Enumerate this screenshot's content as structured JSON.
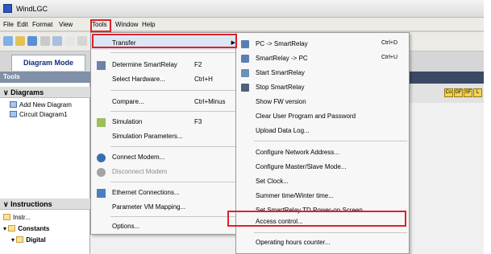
{
  "window": {
    "title": "WindLGC"
  },
  "menubar": [
    "File",
    "Edit",
    "Format",
    "View",
    "Tools",
    "Window",
    "Help"
  ],
  "tabs": {
    "diagram_mode": "Diagram Mode"
  },
  "tools_panel": {
    "header": "Tools",
    "diagrams_section": "Diagrams",
    "add_new_diagram": "Add New Diagram",
    "circuit_diagram": "Circuit Diagram1",
    "instructions_section": "Instructions",
    "instr_item": "Instr...",
    "constants_item": "Constants",
    "digital_item": "Digital"
  },
  "palette_buttons": [
    "Co",
    "GF",
    "SF",
    "L"
  ],
  "tools_menu": {
    "transfer": "Transfer",
    "determine_smartrelay": {
      "label": "Determine SmartRelay",
      "shortcut": "F2"
    },
    "select_hardware": {
      "label": "Select Hardware...",
      "shortcut": "Ctrl+H"
    },
    "compare": {
      "label": "Compare...",
      "shortcut": "Ctrl+Minus"
    },
    "simulation": {
      "label": "Simulation",
      "shortcut": "F3"
    },
    "simulation_parameters": "Simulation Parameters...",
    "connect_modem": "Connect Modem...",
    "disconnect_modem": "Disconnect Modem",
    "ethernet_connections": "Ethernet Connections...",
    "parameter_vm_mapping": "Parameter VM Mapping...",
    "options": "Options..."
  },
  "transfer_menu": {
    "pc_to_smartrelay": {
      "label": "PC -> SmartRelay",
      "shortcut": "Ctrl+D"
    },
    "smartrelay_to_pc": {
      "label": "SmartRelay -> PC",
      "shortcut": "Ctrl+U"
    },
    "start_smartrelay": "Start SmartRelay",
    "stop_smartrelay": "Stop SmartRelay",
    "show_fw_version": "Show FW version",
    "clear_user_program": "Clear User Program and Password",
    "upload_data_log": "Upload Data Log...",
    "configure_network_address": "Configure Network Address...",
    "configure_master_slave": "Configure Master/Slave Mode...",
    "set_clock": "Set Clock...",
    "summer_winter_time": "Summer time/Winter time...",
    "set_td_poweron": "Set SmartRelay TD Power-on Screen...",
    "access_control": "Access control...",
    "operating_hours_counter": "Operating hours counter..."
  },
  "colors": {
    "highlight_border": "#e0202b",
    "panel_header": "#8090a8"
  }
}
